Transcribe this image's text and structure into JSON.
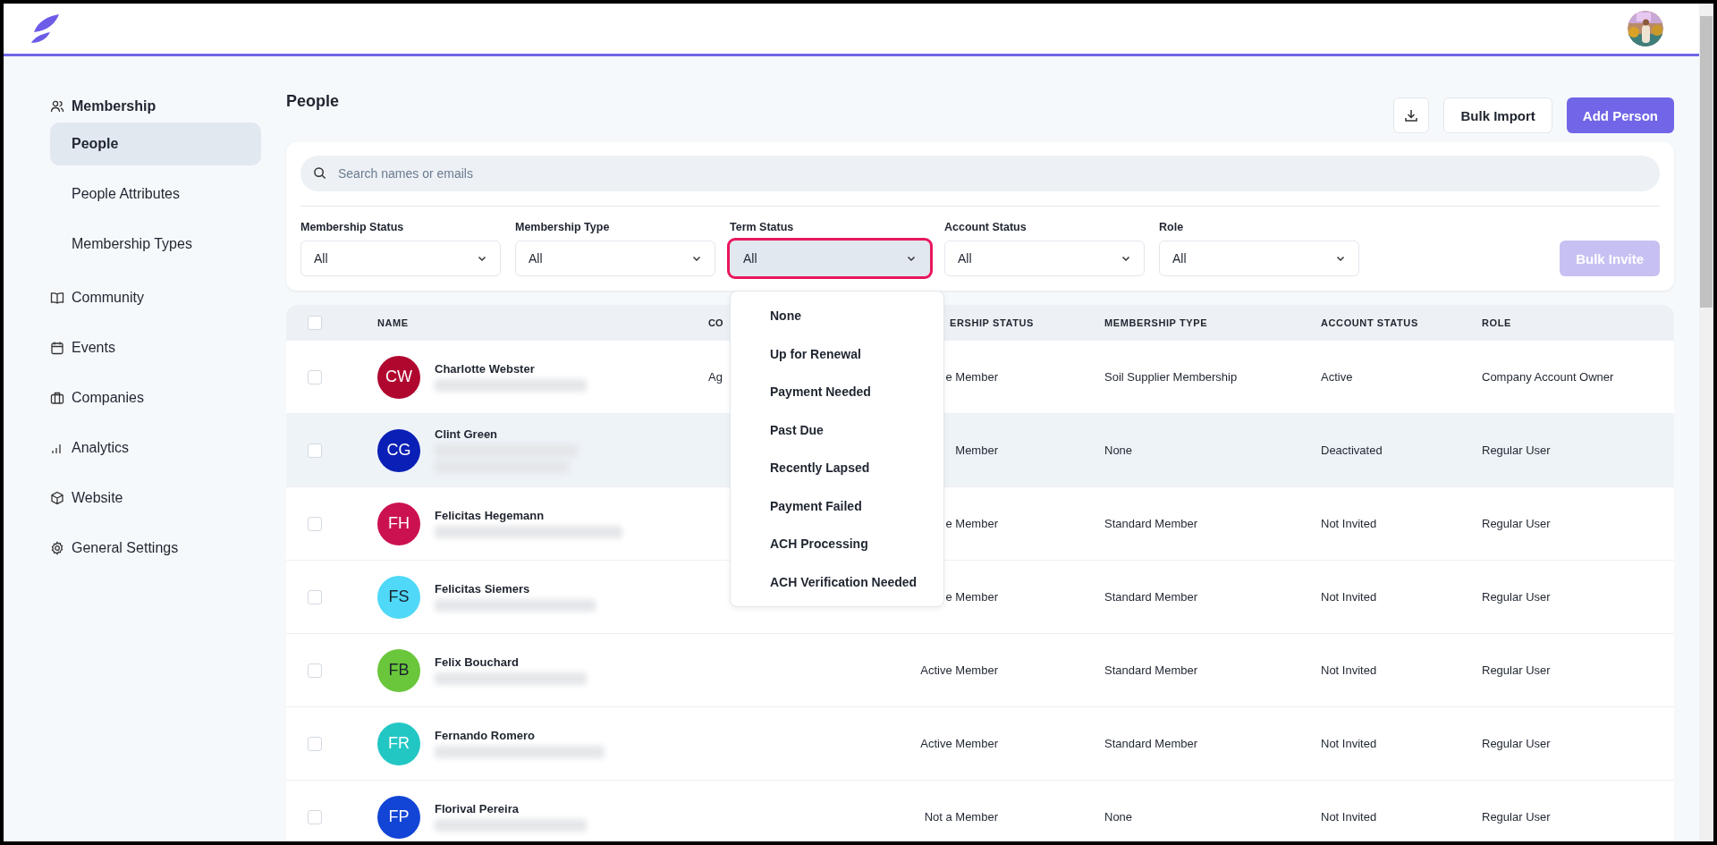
{
  "sidebar": {
    "items": [
      {
        "label": "Membership",
        "expanded": true,
        "children": [
          {
            "label": "People",
            "selected": true
          },
          {
            "label": "People Attributes",
            "selected": false
          },
          {
            "label": "Membership Types",
            "selected": false
          }
        ]
      },
      {
        "label": "Community",
        "expanded": false
      },
      {
        "label": "Events",
        "expanded": false
      },
      {
        "label": "Companies",
        "expanded": false
      },
      {
        "label": "Analytics",
        "expanded": false
      },
      {
        "label": "Website",
        "expanded": false
      },
      {
        "label": "General Settings",
        "expanded": false
      }
    ]
  },
  "page": {
    "title": "People",
    "buttons": [
      {
        "kind": "download"
      },
      {
        "kind": "secondary",
        "label": "Bulk Import"
      },
      {
        "kind": "primary",
        "label": "Add Person"
      }
    ]
  },
  "search": {
    "placeholder": "Search names or emails"
  },
  "filters": [
    {
      "label": "Membership Status",
      "value": "All",
      "open": false,
      "highlighted": false
    },
    {
      "label": "Membership Type",
      "value": "All",
      "open": false,
      "highlighted": false
    },
    {
      "label": "Term Status",
      "value": "All",
      "open": true,
      "highlighted": true
    },
    {
      "label": "Account Status",
      "value": "All",
      "open": false,
      "highlighted": false
    },
    {
      "label": "Role",
      "value": "All",
      "open": false,
      "highlighted": false
    }
  ],
  "bulk_invite": {
    "label": "Bulk Invite",
    "disabled": true
  },
  "dropdown": {
    "options": [
      {
        "label": "None",
        "selected": false
      },
      {
        "label": "Up for Renewal",
        "selected": false
      },
      {
        "label": "Payment Needed",
        "selected": false
      },
      {
        "label": "Past Due",
        "selected": false
      },
      {
        "label": "Recently Lapsed",
        "selected": false
      },
      {
        "label": "Payment Failed",
        "selected": false
      },
      {
        "label": "ACH Processing",
        "selected": false
      },
      {
        "label": "ACH Verification Needed",
        "selected": false
      }
    ]
  },
  "table": {
    "header_checked": false,
    "columns": [
      "NAME",
      "CO",
      "ERSHIP STATUS",
      "MEMBERSHIP TYPE",
      "ACCOUNT STATUS",
      "ROLE"
    ],
    "rows": [
      {
        "initials": "CW",
        "color": "#b0072f",
        "name": "Charlotte Webster",
        "company": "Ag",
        "membership_status": "e Member",
        "membership_type": "Soil Supplier Membership",
        "account_status": "Active",
        "role": "Company Account Owner",
        "checked": false,
        "highlighted": false
      },
      {
        "initials": "CG",
        "color": "#0a1fb5",
        "name": "Clint Green",
        "membership_status": "Member",
        "membership_type": "None",
        "account_status": "Deactivated",
        "role": "Regular User",
        "checked": false,
        "highlighted": true
      },
      {
        "initials": "FH",
        "color": "#cc1150",
        "name": "Felicitas Hegemann",
        "membership_status": "e Member",
        "membership_type": "Standard Member",
        "account_status": "Not Invited",
        "role": "Regular User",
        "checked": false,
        "highlighted": false
      },
      {
        "initials": "FS",
        "color": "#4fd8f7",
        "name": "Felicitas Siemers",
        "membership_status": "e Member",
        "membership_type": "Standard Member",
        "account_status": "Not Invited",
        "role": "Regular User",
        "checked": false,
        "highlighted": false
      },
      {
        "initials": "FB",
        "color": "#6ac63b",
        "name": "Felix Bouchard",
        "membership_status": "Active Member",
        "membership_type": "Standard Member",
        "account_status": "Not Invited",
        "role": "Regular User",
        "checked": false,
        "highlighted": false
      },
      {
        "initials": "FR",
        "color": "#22c7c3",
        "name": "Fernando Romero",
        "membership_status": "Active Member",
        "membership_type": "Standard Member",
        "account_status": "Not Invited",
        "role": "Regular User",
        "checked": false,
        "highlighted": false
      },
      {
        "initials": "FP",
        "color": "#1245d6",
        "name": "Florival Pereira",
        "membership_status": "Not a Member",
        "membership_type": "None",
        "account_status": "Not Invited",
        "role": "Regular User",
        "checked": false,
        "highlighted": false
      }
    ]
  }
}
